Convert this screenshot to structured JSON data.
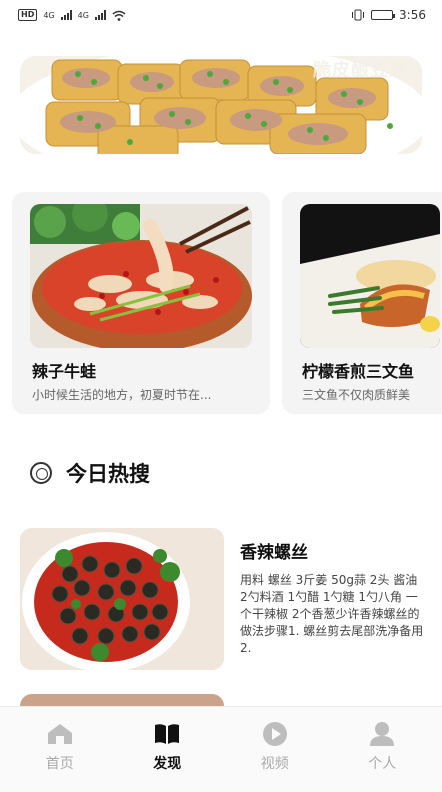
{
  "status_bar": {
    "network_badge": "HD",
    "network_1": "4G",
    "network_2": "4G",
    "time": "3:56"
  },
  "banner": {
    "title": "脆皮酿豆腐"
  },
  "cards": [
    {
      "title": "辣子牛蛙",
      "desc": "小时候生活的地方，初夏时节在..."
    },
    {
      "title": "柠檬香煎三文鱼",
      "desc": "三文鱼不仅肉质鲜美"
    }
  ],
  "section": {
    "title": "今日热搜"
  },
  "hot_list": [
    {
      "title": "香辣螺丝",
      "desc": "用料  螺丝  3斤姜 50g蒜 2头  酱油 2勺料酒  1勺醋  1勺糖 1勺八角  一个干辣椒  2个香葱少许香辣螺丝的做法步骤1. 螺丝剪去尾部洗净备用2."
    }
  ],
  "tabbar": {
    "items": [
      {
        "label": "首页",
        "icon": "home-icon",
        "active": false
      },
      {
        "label": "发现",
        "icon": "book-icon",
        "active": true
      },
      {
        "label": "视频",
        "icon": "play-icon",
        "active": false
      },
      {
        "label": "个人",
        "icon": "person-icon",
        "active": false
      }
    ]
  },
  "colors": {
    "accent": "#111111",
    "inactive": "#aaaaaa",
    "card_bg": "#f4f4f4"
  }
}
